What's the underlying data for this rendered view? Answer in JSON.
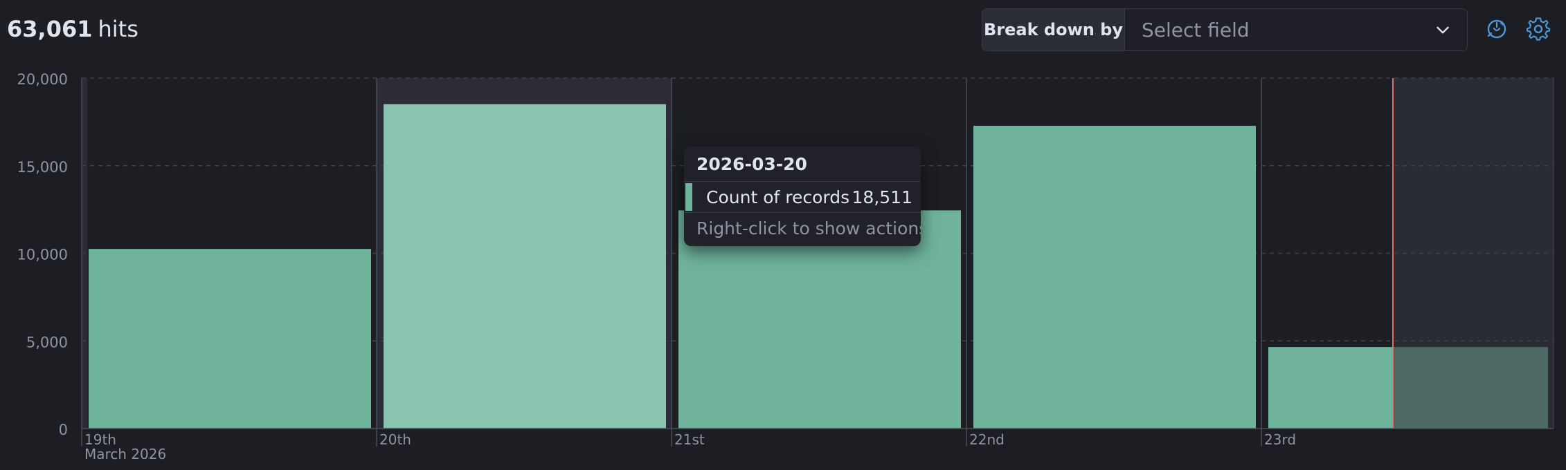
{
  "header": {
    "hits_count": "63,061",
    "hits_label": "hits"
  },
  "breakdown": {
    "label": "Break down by",
    "placeholder": "Select field"
  },
  "icons": {
    "assistant": "assistant-icon",
    "settings": "gear-icon",
    "dropdown": "chevron-down-icon"
  },
  "colors": {
    "bar": "#6fb39b",
    "bar_highlight": "#8ac4ae",
    "bar_partial": "#4c6a63",
    "now_marker": "#e0726e",
    "accent": "#4d97d9"
  },
  "chart_data": {
    "type": "bar",
    "categories": [
      "19th",
      "20th",
      "21st",
      "22nd",
      "23rd"
    ],
    "category_sublabel": "March 2026",
    "series": [
      {
        "name": "Count of records",
        "values": [
          10250,
          18511,
          12450,
          17280,
          4650
        ]
      }
    ],
    "ylim": [
      0,
      20000
    ],
    "y_ticks": [
      "0",
      "5,000",
      "10,000",
      "15,000",
      "20,000"
    ],
    "y_tick_values": [
      0,
      5000,
      10000,
      15000,
      20000
    ],
    "grid": true,
    "highlighted_category": "20th",
    "partial_last_bucket": true
  },
  "tooltip": {
    "date": "2026-03-20",
    "series_name": "Count of records",
    "value": "18,511",
    "hint": "Right-click to show actions"
  }
}
